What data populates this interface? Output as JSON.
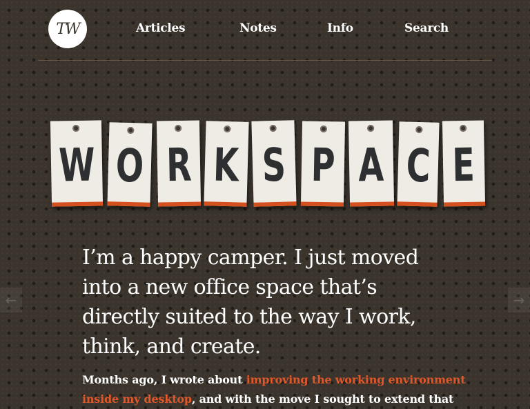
{
  "header": {
    "logo_text": "TW",
    "nav": [
      {
        "label": "Articles"
      },
      {
        "label": "Notes"
      },
      {
        "label": "Info"
      },
      {
        "label": "Search"
      }
    ]
  },
  "hero": {
    "letters": [
      "W",
      "O",
      "R",
      "K",
      "S",
      "P",
      "A",
      "C",
      "E"
    ]
  },
  "article": {
    "intro_lines": [
      "I’m a happy camper. I just moved",
      "into a new office space that’s",
      "directly suited to the way I work,",
      "think, and create."
    ],
    "body_prefix": "Months ago, I wrote about ",
    "body_link": "improving the working environment",
    "body_link_line2": "inside my desktop",
    "body_suffix": ", and with the move I sought to extend that"
  },
  "nav_arrows": {
    "prev_icon": "left-arrow-icon",
    "next_icon": "right-arrow-icon"
  },
  "colors": {
    "background": "#3b342d",
    "accent": "#e0582a",
    "tag": "#efece6",
    "tag_stripe": "#d5501f"
  }
}
